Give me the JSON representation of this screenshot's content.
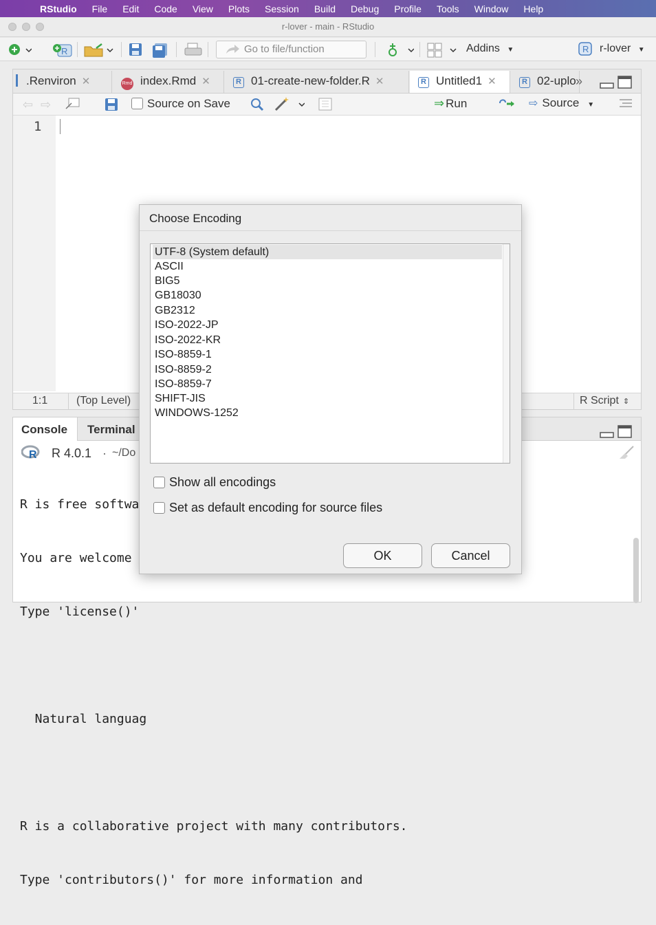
{
  "menubar": {
    "app": "RStudio",
    "items": [
      "File",
      "Edit",
      "Code",
      "View",
      "Plots",
      "Session",
      "Build",
      "Debug",
      "Profile",
      "Tools",
      "Window",
      "Help"
    ]
  },
  "window": {
    "title": "r-lover - main - RStudio"
  },
  "toolbar": {
    "goto_placeholder": "Go to file/function",
    "addins": "Addins",
    "project": "r-lover"
  },
  "editor": {
    "tabs": [
      {
        "label": ".Renviron",
        "icon": "file-icon"
      },
      {
        "label": "index.Rmd",
        "icon": "rmd-icon"
      },
      {
        "label": "01-create-new-folder.R",
        "icon": "r-file-icon"
      },
      {
        "label": "Untitled1",
        "icon": "r-file-icon",
        "active": true
      },
      {
        "label": "02-uplo",
        "icon": "r-file-icon"
      }
    ],
    "source_on_save": "Source on Save",
    "run": "Run",
    "source": "Source",
    "line_number": "1",
    "status_position": "1:1",
    "status_scope": "(Top Level)",
    "file_type": "R Script"
  },
  "console": {
    "tabs": [
      "Console",
      "Terminal"
    ],
    "r_version": "R 4.0.1",
    "path": "~/Do",
    "lines": [
      "R is free softwa",
      "You are welcome t",
      "Type 'license()'",
      "",
      "  Natural languag",
      "",
      "R is a collaborative project with many contributors.",
      "Type 'contributors()' for more information and"
    ]
  },
  "dialog": {
    "title": "Choose Encoding",
    "encodings": [
      "UTF-8 (System default)",
      "ASCII",
      "BIG5",
      "GB18030",
      "GB2312",
      "ISO-2022-JP",
      "ISO-2022-KR",
      "ISO-8859-1",
      "ISO-8859-2",
      "ISO-8859-7",
      "SHIFT-JIS",
      "WINDOWS-1252"
    ],
    "selected": "UTF-8 (System default)",
    "show_all": "Show all encodings",
    "set_default": "Set as default encoding for source files",
    "ok": "OK",
    "cancel": "Cancel"
  }
}
